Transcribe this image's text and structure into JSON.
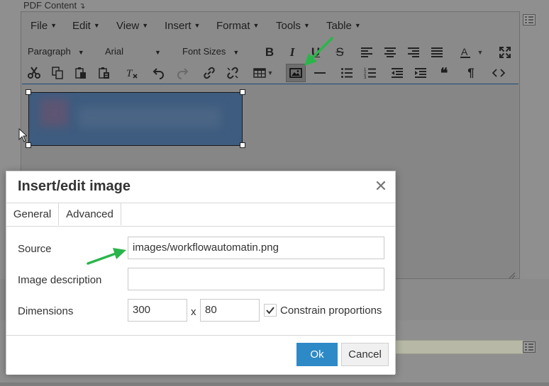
{
  "background": {
    "section_label": "PDF Content",
    "menu": [
      "File",
      "Edit",
      "View",
      "Insert",
      "Format",
      "Tools",
      "Table"
    ],
    "toolbar": {
      "block_format": "Paragraph",
      "font_family": "Arial",
      "font_size": "Font Sizes",
      "paragraph_mark": "¶",
      "quote_mark": "❝"
    }
  },
  "dialog": {
    "title": "Insert/edit image",
    "tabs": [
      "General",
      "Advanced"
    ],
    "source_label": "Source",
    "source_value": "images/workflowautomatin.png",
    "description_label": "Image description",
    "description_value": "",
    "dimensions_label": "Dimensions",
    "width_value": "300",
    "times": "x",
    "height_value": "80",
    "constrain_label": "Constrain proportions",
    "constrain_checked": true,
    "ok_label": "Ok",
    "cancel_label": "Cancel"
  },
  "colors": {
    "accent": "#2d8ac7",
    "arrow": "#2ab54a",
    "overlay": "#8f8f8f"
  },
  "icons": [
    "cut-icon",
    "copy-icon",
    "paste-icon",
    "paste-text-icon",
    "clear-format-icon",
    "undo-icon",
    "redo-icon",
    "link-icon",
    "unlink-icon",
    "table-icon",
    "image-icon",
    "horizontal-rule-icon",
    "bullet-list-icon",
    "numbered-list-icon",
    "outdent-icon",
    "indent-icon",
    "blockquote-icon",
    "show-blocks-icon",
    "code-icon",
    "bold-icon",
    "italic-icon",
    "underline-icon",
    "strikethrough-icon",
    "align-left-icon",
    "align-center-icon",
    "align-right-icon",
    "align-justify-icon",
    "text-color-icon",
    "fullscreen-icon",
    "close-icon"
  ]
}
